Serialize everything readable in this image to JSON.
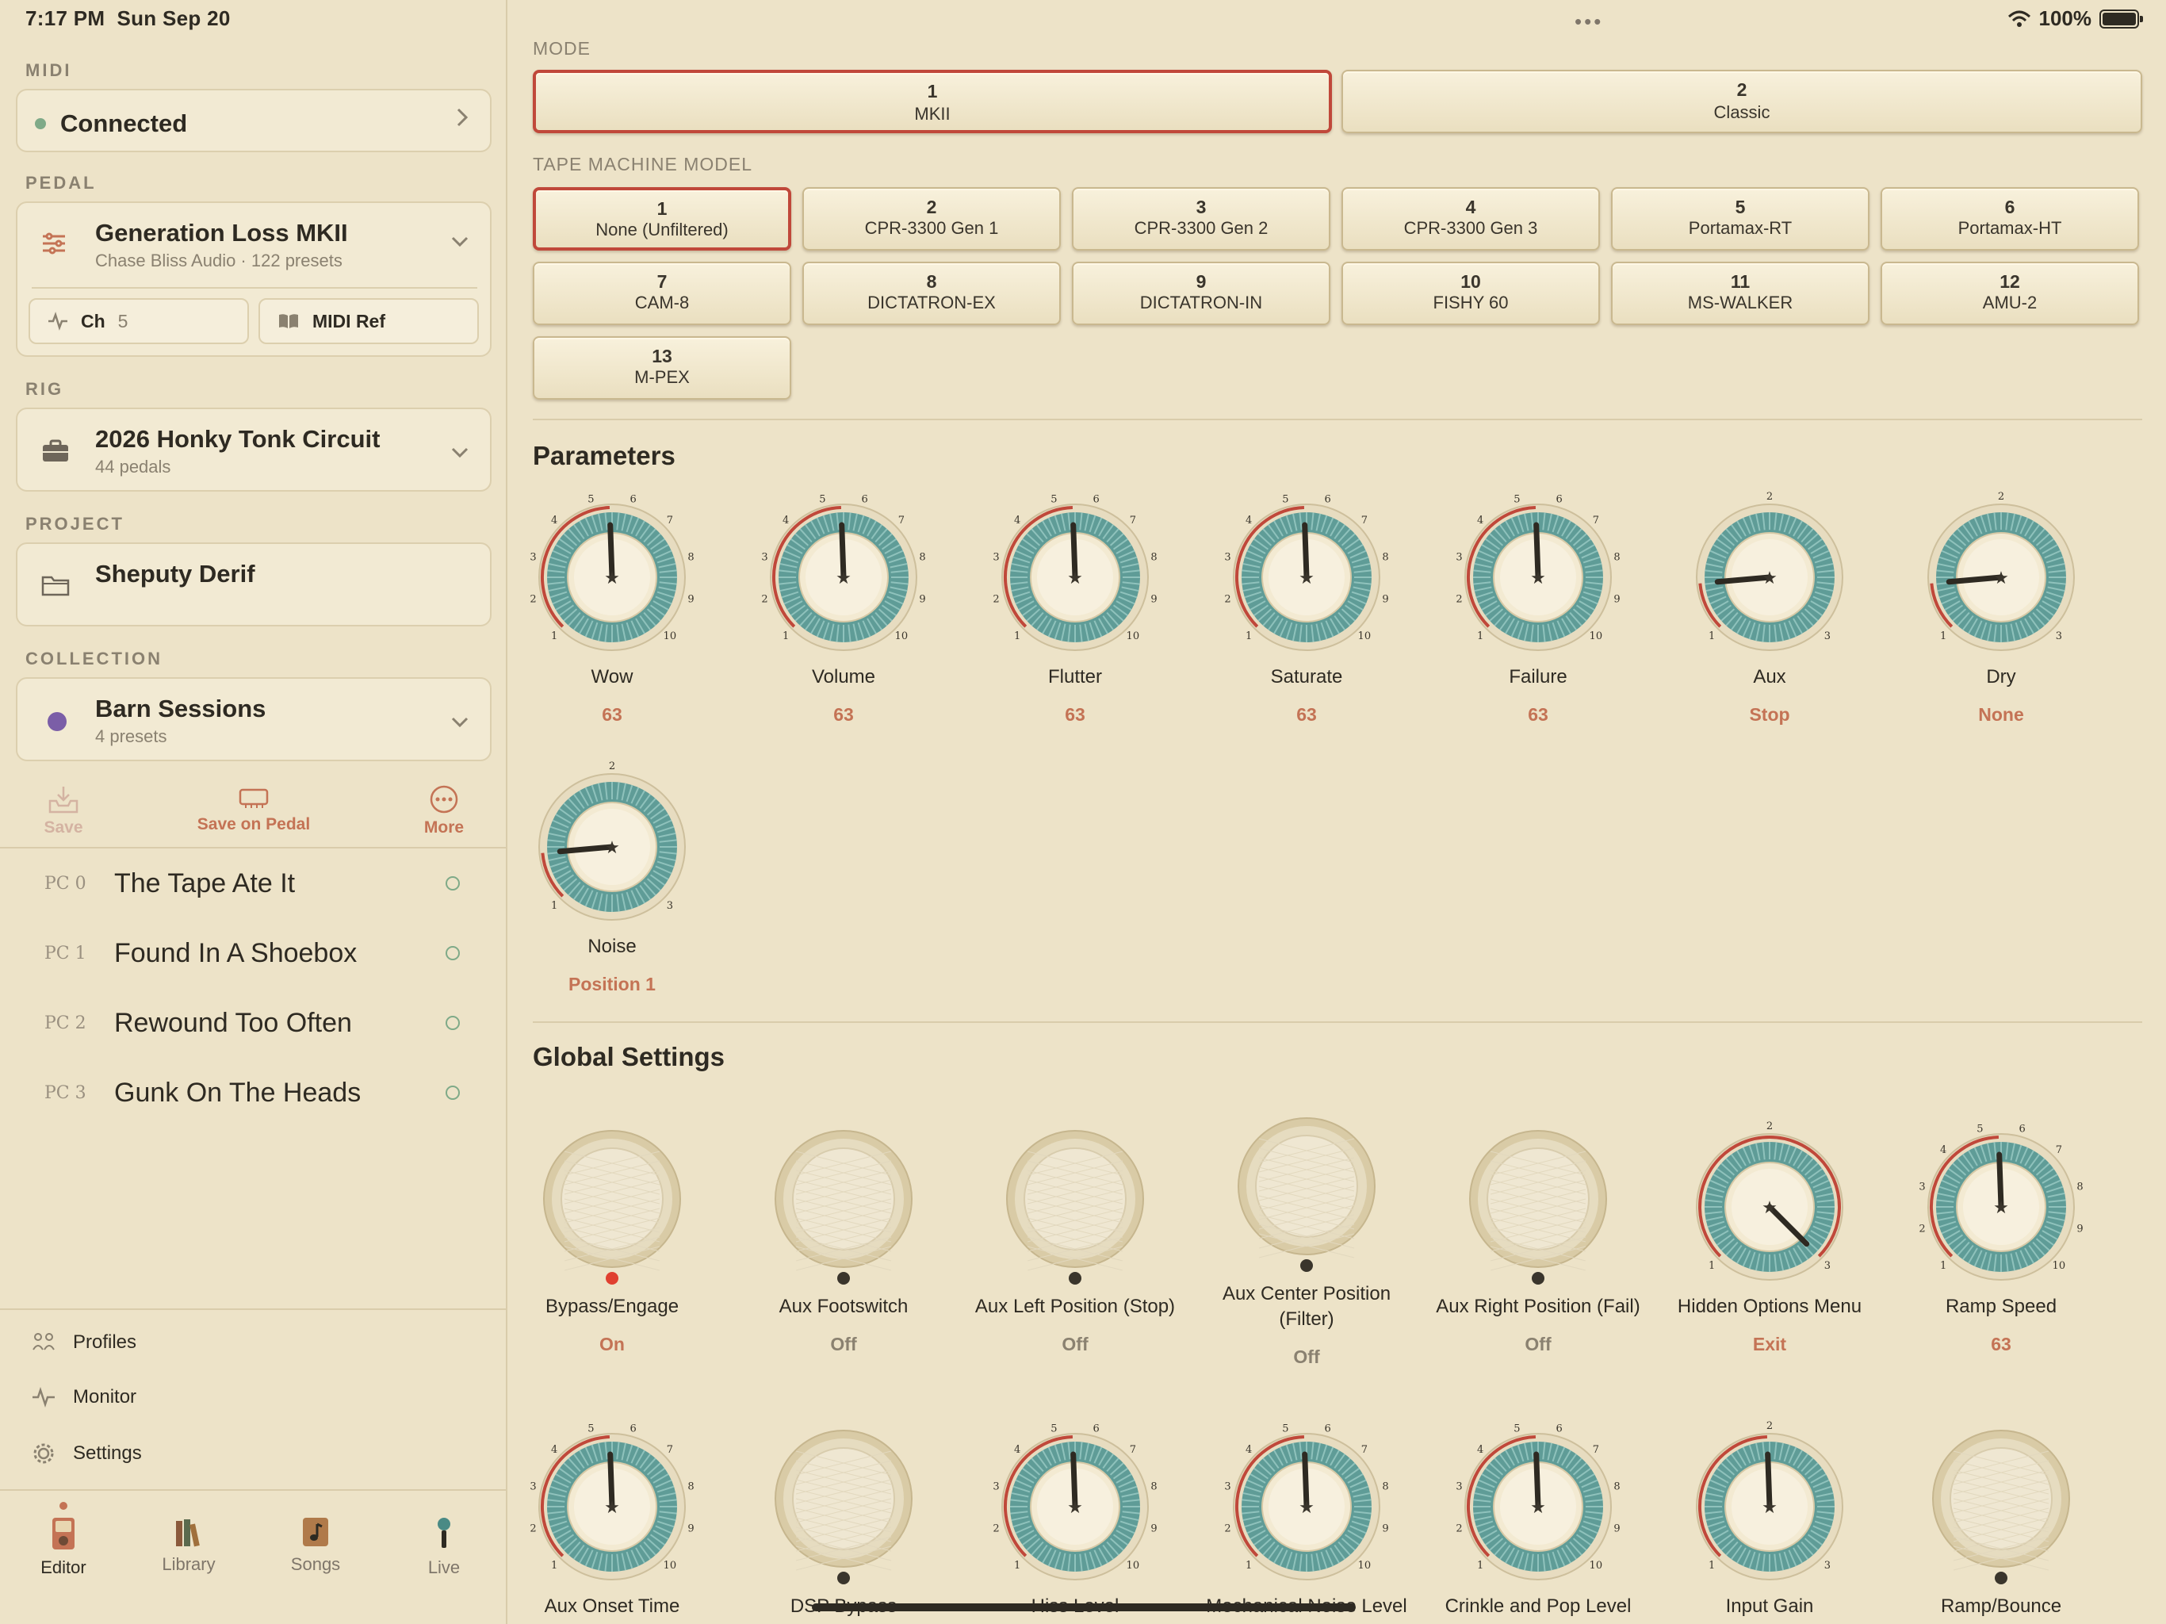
{
  "status": {
    "time": "7:17 PM",
    "date": "Sun Sep 20",
    "battery": "100%"
  },
  "sidebar": {
    "midi_label": "MIDI",
    "midi_status": "Connected",
    "pedal_label": "PEDAL",
    "pedal_name": "Generation Loss MKII",
    "pedal_sub": "Chase Bliss Audio · 122 presets",
    "ch_label": "Ch",
    "ch_value": "5",
    "midi_ref": "MIDI Ref",
    "rig_label": "RIG",
    "rig_name": "2026 Honky Tonk Circuit",
    "rig_sub": "44 pedals",
    "project_label": "PROJECT",
    "project_name": "Sheputy Derif",
    "collection_label": "COLLECTION",
    "collection_name": "Barn Sessions",
    "collection_sub": "4 presets",
    "collection_color": "#7b5ea7",
    "actions": {
      "save": "Save",
      "save_on_pedal": "Save on Pedal",
      "more": "More"
    },
    "presets": [
      {
        "pc": "PC 0",
        "name": "The Tape Ate It"
      },
      {
        "pc": "PC 1",
        "name": "Found In A Shoebox"
      },
      {
        "pc": "PC 2",
        "name": "Rewound Too Often"
      },
      {
        "pc": "PC 3",
        "name": "Gunk On The Heads"
      }
    ],
    "links": {
      "profiles": "Profiles",
      "monitor": "Monitor",
      "settings": "Settings"
    },
    "tabs": {
      "editor": "Editor",
      "library": "Library",
      "songs": "Songs",
      "live": "Live"
    }
  },
  "main": {
    "mode_label": "MODE",
    "modes": [
      {
        "n": "1",
        "l": "MKII"
      },
      {
        "n": "2",
        "l": "Classic"
      }
    ],
    "selected_mode": "1",
    "tape_label": "TAPE MACHINE MODEL",
    "tapes": [
      {
        "n": "1",
        "l": "None (Unfiltered)"
      },
      {
        "n": "2",
        "l": "CPR-3300 Gen 1"
      },
      {
        "n": "3",
        "l": "CPR-3300 Gen 2"
      },
      {
        "n": "4",
        "l": "CPR-3300 Gen 3"
      },
      {
        "n": "5",
        "l": "Portamax-RT"
      },
      {
        "n": "6",
        "l": "Portamax-HT"
      },
      {
        "n": "7",
        "l": "CAM-8"
      },
      {
        "n": "8",
        "l": "DICTATRON-EX"
      },
      {
        "n": "9",
        "l": "DICTATRON-IN"
      },
      {
        "n": "10",
        "l": "FISHY 60"
      },
      {
        "n": "11",
        "l": "MS-WALKER"
      },
      {
        "n": "12",
        "l": "AMU-2"
      },
      {
        "n": "13",
        "l": "M-PEX"
      }
    ],
    "selected_tape": "1",
    "parameters_title": "Parameters",
    "parameters": [
      {
        "name": "Wow",
        "value": "63"
      },
      {
        "name": "Volume",
        "value": "63"
      },
      {
        "name": "Flutter",
        "value": "63"
      },
      {
        "name": "Saturate",
        "value": "63"
      },
      {
        "name": "Failure",
        "value": "63"
      },
      {
        "name": "Aux",
        "value": "Stop"
      },
      {
        "name": "Dry",
        "value": "None"
      },
      {
        "name": "Noise",
        "value": "Position 1"
      }
    ],
    "global_title": "Global Settings",
    "globals": [
      {
        "name": "Bypass/Engage",
        "value": "On"
      },
      {
        "name": "Aux Footswitch",
        "value": "Off"
      },
      {
        "name": "Aux Left Position (Stop)",
        "value": "Off"
      },
      {
        "name": "Aux Center Position (Filter)",
        "value": "Off"
      },
      {
        "name": "Aux Right Position (Fail)",
        "value": "Off"
      },
      {
        "name": "Hidden Options Menu",
        "value": "Exit"
      },
      {
        "name": "Ramp Speed",
        "value": "63"
      }
    ],
    "globals2": [
      {
        "name": "Aux Onset Time"
      },
      {
        "name": "DSP Bypass"
      },
      {
        "name": "Hiss Level"
      },
      {
        "name": "Mechanical Noise Level"
      },
      {
        "name": "Crinkle and Pop Level"
      },
      {
        "name": "Input Gain"
      },
      {
        "name": "Ramp/Bounce"
      }
    ]
  }
}
